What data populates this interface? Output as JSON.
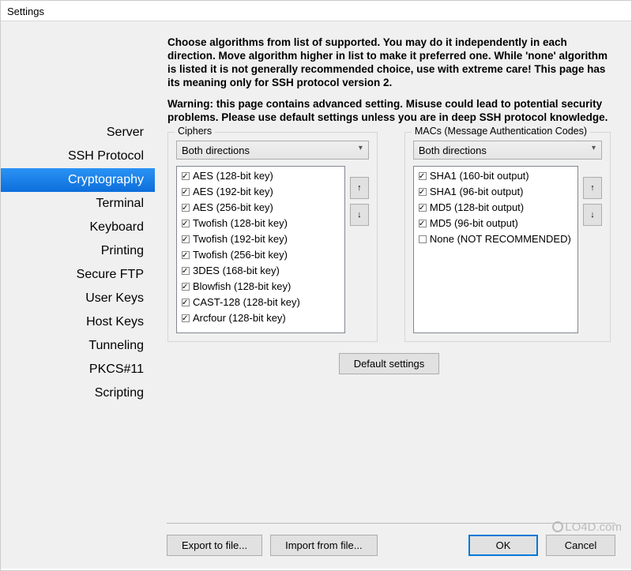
{
  "window": {
    "title": "Settings"
  },
  "sidebar": {
    "items": [
      {
        "label": "Server",
        "selected": false
      },
      {
        "label": "SSH Protocol",
        "selected": false
      },
      {
        "label": "Cryptography",
        "selected": true
      },
      {
        "label": "Terminal",
        "selected": false
      },
      {
        "label": "Keyboard",
        "selected": false
      },
      {
        "label": "Printing",
        "selected": false
      },
      {
        "label": "Secure FTP",
        "selected": false
      },
      {
        "label": "User Keys",
        "selected": false
      },
      {
        "label": "Host Keys",
        "selected": false
      },
      {
        "label": "Tunneling",
        "selected": false
      },
      {
        "label": "PKCS#11",
        "selected": false
      },
      {
        "label": "Scripting",
        "selected": false
      }
    ]
  },
  "main": {
    "description": "Choose algorithms from list of supported. You may do it independently in each direction. Move algorithm higher in list to make it preferred one. While 'none' algorithm is listed it is not generally recommended choice, use with extreme care! This page has its meaning only for SSH protocol version 2.",
    "warning": "Warning: this page contains advanced setting. Misuse could lead to potential security problems. Please use default settings unless you are in deep SSH protocol knowledge."
  },
  "ciphers": {
    "group_label": "Ciphers",
    "direction": "Both directions",
    "items": [
      {
        "label": "AES (128-bit key)",
        "checked": true
      },
      {
        "label": "AES (192-bit key)",
        "checked": true
      },
      {
        "label": "AES (256-bit key)",
        "checked": true
      },
      {
        "label": "Twofish (128-bit key)",
        "checked": true
      },
      {
        "label": "Twofish (192-bit key)",
        "checked": true
      },
      {
        "label": "Twofish (256-bit key)",
        "checked": true
      },
      {
        "label": "3DES (168-bit key)",
        "checked": true
      },
      {
        "label": "Blowfish (128-bit key)",
        "checked": true
      },
      {
        "label": "CAST-128 (128-bit key)",
        "checked": true
      },
      {
        "label": "Arcfour (128-bit key)",
        "checked": true
      }
    ]
  },
  "macs": {
    "group_label": "MACs (Message Authentication Codes)",
    "direction": "Both directions",
    "items": [
      {
        "label": "SHA1 (160-bit output)",
        "checked": true
      },
      {
        "label": "SHA1 (96-bit output)",
        "checked": true
      },
      {
        "label": "MD5 (128-bit output)",
        "checked": true
      },
      {
        "label": "MD5 (96-bit output)",
        "checked": true
      },
      {
        "label": "None (NOT RECOMMENDED)",
        "checked": false
      }
    ]
  },
  "buttons": {
    "default_settings": "Default settings",
    "export": "Export to file...",
    "import": "Import from file...",
    "ok": "OK",
    "cancel": "Cancel",
    "up_glyph": "↑",
    "down_glyph": "↓"
  },
  "watermark": "LO4D.com"
}
